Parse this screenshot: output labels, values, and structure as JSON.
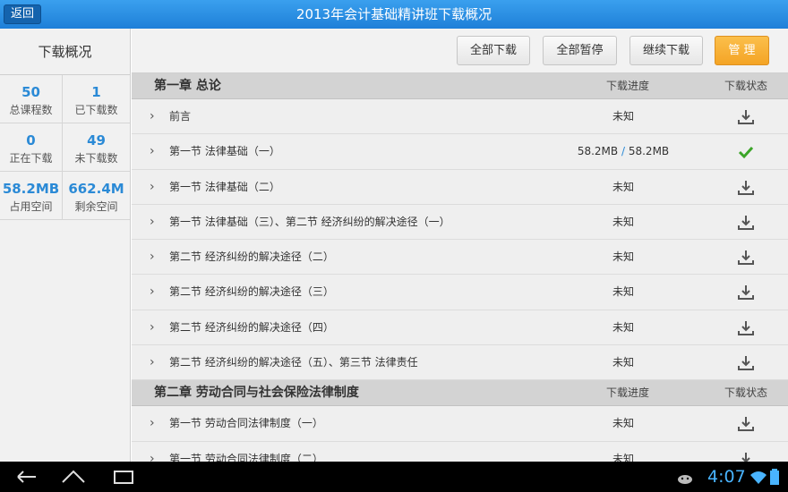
{
  "header": {
    "title": "2013年会计基础精讲班下载概况",
    "back_label": "返回"
  },
  "sidebar": {
    "title": "下载概况",
    "stats": [
      {
        "value": "50",
        "label": "总课程数"
      },
      {
        "value": "1",
        "label": "已下载数"
      },
      {
        "value": "0",
        "label": "正在下载"
      },
      {
        "value": "49",
        "label": "未下载数"
      },
      {
        "value": "58.2MB",
        "label": "占用空间"
      },
      {
        "value": "662.4M",
        "label": "剩余空间"
      }
    ]
  },
  "toolbar": {
    "download_all": "全部下载",
    "pause_all": "全部暂停",
    "continue": "继续下载",
    "manage": "管 理"
  },
  "chapters": [
    {
      "title": "第一章 总论",
      "progress_header": "下载进度",
      "status_header": "下载状态",
      "lessons": [
        {
          "title": "前言",
          "progress": "未知",
          "status": "download"
        },
        {
          "title": "第一节 法律基础（一）",
          "progress_done": "58.2MB",
          "progress_sep": "/",
          "progress_total": "58.2MB",
          "status": "done"
        },
        {
          "title": "第一节 法律基础（二）",
          "progress": "未知",
          "status": "download"
        },
        {
          "title": "第一节 法律基础（三）、第二节 经济纠纷的解决途径（一）",
          "progress": "未知",
          "status": "download"
        },
        {
          "title": "第二节 经济纠纷的解决途径（二）",
          "progress": "未知",
          "status": "download"
        },
        {
          "title": "第二节 经济纠纷的解决途径（三）",
          "progress": "未知",
          "status": "download"
        },
        {
          "title": "第二节 经济纠纷的解决途径（四）",
          "progress": "未知",
          "status": "download"
        },
        {
          "title": "第二节 经济纠纷的解决途径（五）、第三节 法律责任",
          "progress": "未知",
          "status": "download"
        }
      ]
    },
    {
      "title": "第二章 劳动合同与社会保险法律制度",
      "progress_header": "下载进度",
      "status_header": "下载状态",
      "lessons": [
        {
          "title": "第一节 劳动合同法律制度（一）",
          "progress": "未知",
          "status": "download"
        },
        {
          "title": "第一节 劳动合同法律制度（二）",
          "progress": "未知",
          "status": "download"
        }
      ]
    }
  ],
  "status_bar": {
    "time": "4:07"
  },
  "colors": {
    "accent": "#2b8ad6",
    "manage": "#f4a425",
    "done": "#3ba528"
  }
}
